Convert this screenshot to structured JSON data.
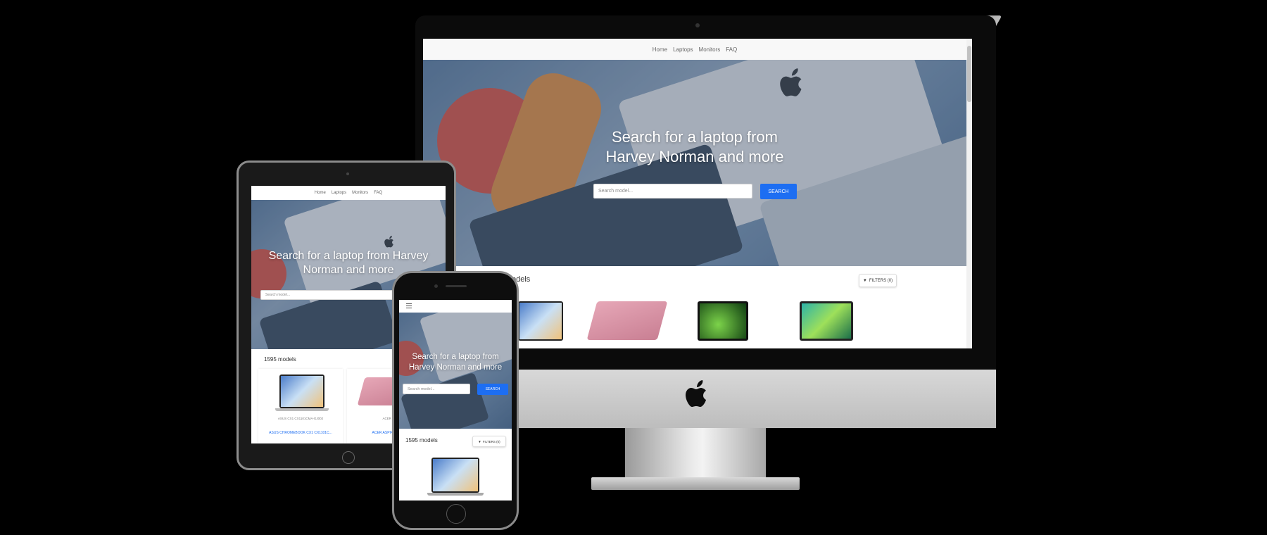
{
  "desktop": {
    "nav": [
      "Home",
      "Laptops",
      "Monitors",
      "FAQ"
    ],
    "hero_title_line1": "Search for a laptop from",
    "hero_title_line2": "Harvey Norman and more",
    "search_placeholder": "Search model...",
    "search_button": "SEARCH",
    "models_heading": "odels",
    "filters_label": "FILTERS (0)"
  },
  "tablet": {
    "nav": [
      "Home",
      "Laptops",
      "Monitors",
      "FAQ"
    ],
    "hero_title_line1": "Search for a laptop from Harvey",
    "hero_title_line2": "Norman and more",
    "search_placeholder": "Search model...",
    "models_count": "1595 models",
    "card1_sub": "ASUS CX1 CX1101CMA-GJ002",
    "card1_link": "ASUS CHROMEBOOK CX1 CX1101C...",
    "card2_sub": "ACER A1",
    "card2_link": "ACER ASPIRE 1 A1..."
  },
  "phone": {
    "menu_icon": "hamburger-icon",
    "hero_title_line1": "Search for a laptop from",
    "hero_title_line2": "Harvey Norman and more",
    "search_placeholder": "Search model...",
    "search_button": "SEARCH",
    "models_count": "1595 models",
    "filters_label": "FILTERS (0)"
  },
  "colors": {
    "accent": "#1d6ef2",
    "page_bg": "#000000",
    "bezel": "#1a1a1a"
  }
}
